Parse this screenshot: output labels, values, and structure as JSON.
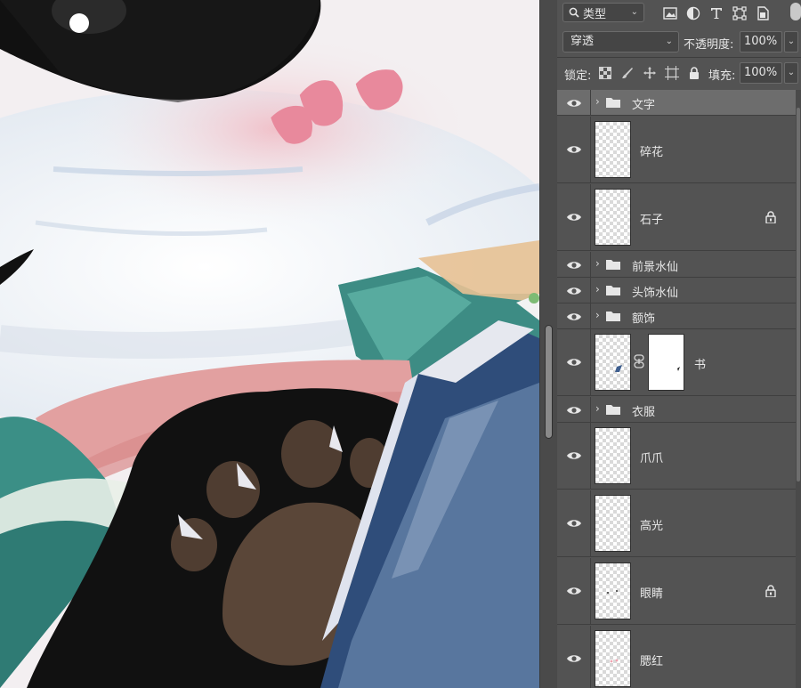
{
  "layers_panel": {
    "filter": {
      "icon": "search-icon",
      "label": "类型"
    },
    "filter_icons": [
      "image-filter-icon",
      "adjustment-filter-icon",
      "text-filter-icon",
      "shape-filter-icon",
      "smart-object-filter-icon"
    ],
    "blend_mode": "穿透",
    "opacity_label": "不透明度:",
    "opacity_value": "100%",
    "lock_label": "锁定:",
    "lock_icons": [
      "lock-transparent-pixels-icon",
      "lock-image-pixels-icon",
      "lock-position-icon",
      "lock-artboard-icon",
      "lock-all-icon"
    ],
    "fill_label": "填充:",
    "fill_value": "100%",
    "layers": [
      {
        "name": "文字",
        "type": "group",
        "visible": true,
        "selected": true
      },
      {
        "name": "碎花",
        "type": "layer",
        "visible": true
      },
      {
        "name": "石子",
        "type": "layer",
        "visible": true,
        "locked": true
      },
      {
        "name": "前景水仙",
        "type": "group",
        "visible": true
      },
      {
        "name": "头饰水仙",
        "type": "group",
        "visible": true
      },
      {
        "name": "额饰",
        "type": "group",
        "visible": true
      },
      {
        "name": "书",
        "type": "layer",
        "visible": true,
        "has_mask": true
      },
      {
        "name": "衣服",
        "type": "group",
        "visible": true
      },
      {
        "name": "爪爪",
        "type": "layer",
        "visible": true
      },
      {
        "name": "高光",
        "type": "layer",
        "visible": true
      },
      {
        "name": "眼睛",
        "type": "layer",
        "visible": true,
        "locked": true
      },
      {
        "name": "腮红",
        "type": "layer",
        "visible": true
      }
    ]
  },
  "colors": {
    "panel_bg": "#535353",
    "selected_row": "#6d6d6d",
    "book_blue": "#3f5f8f",
    "paw_black": "#111111",
    "paw_pad": "#5a4638",
    "cheek_pink": "#e98fa2",
    "teal": "#3b8f86"
  }
}
